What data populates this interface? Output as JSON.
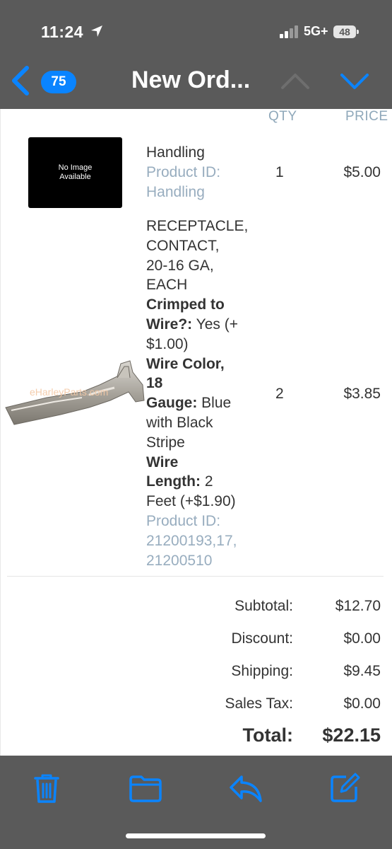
{
  "status_bar": {
    "time": "11:24",
    "network": "5G+",
    "battery": "48"
  },
  "nav": {
    "badge_count": "75",
    "title": "New Ord..."
  },
  "table": {
    "qty_header": "QTY",
    "price_header": "PRICE",
    "items": [
      {
        "image_placeholder": "No Image Available",
        "name": "Handling",
        "product_id_label": "Product ID:",
        "product_id": "Handling",
        "qty": "1",
        "price": "$5.00"
      },
      {
        "image_watermark": "eHarleyParts.com",
        "name_lines": [
          "RECEPTACLE,",
          "CONTACT,",
          "20-16 GA,",
          "EACH"
        ],
        "opt1_label_lines": [
          "Crimped to",
          "Wire?:"
        ],
        "opt1_value_lines": [
          " Yes (+",
          "$1.00)"
        ],
        "opt2_label_lines": [
          "Wire Color,",
          "18",
          "Gauge:"
        ],
        "opt2_value_lines": [
          " Blue",
          "with Black",
          "Stripe"
        ],
        "opt3_label_lines": [
          "Wire",
          "Length:"
        ],
        "opt3_value_lines": [
          " 2",
          "Feet (+$1.90)"
        ],
        "product_id_label": "Product ID:",
        "product_id_lines": [
          "21200193,17,",
          "21200510"
        ],
        "qty": "2",
        "price": "$3.85"
      }
    ]
  },
  "totals": {
    "subtotal_label": "Subtotal:",
    "subtotal": "$12.70",
    "discount_label": "Discount:",
    "discount": "$0.00",
    "shipping_label": "Shipping:",
    "shipping": "$9.45",
    "tax_label": "Sales Tax:",
    "tax": "$0.00",
    "total_label": "Total:",
    "total": "$22.15"
  },
  "toolbar": {
    "icons": [
      "trash-icon",
      "folder-icon",
      "reply-icon",
      "compose-icon"
    ]
  },
  "colors": {
    "accent": "#0a84ff",
    "chrome": "#5a5a5a",
    "muted_text": "#98adbf"
  }
}
